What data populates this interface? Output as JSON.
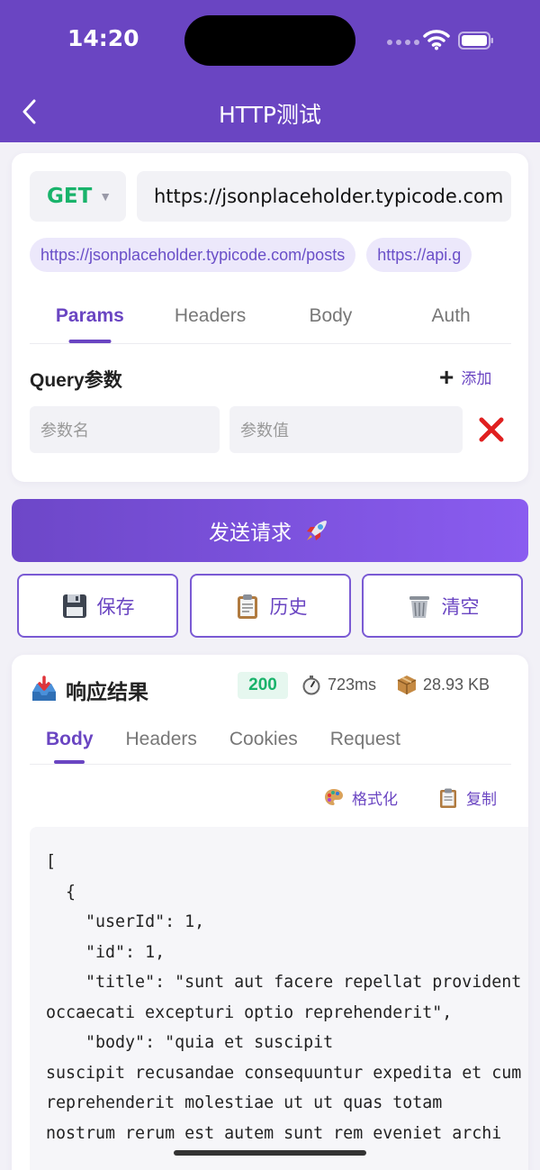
{
  "status_bar": {
    "time": "14:20"
  },
  "nav": {
    "title": "HTTP测试"
  },
  "request": {
    "method": "GET",
    "url": "https://jsonplaceholder.typicode.com",
    "quick_urls": [
      "https://jsonplaceholder.typicode.com/posts",
      "https://api.g"
    ],
    "tabs": [
      "Params",
      "Headers",
      "Body",
      "Auth"
    ],
    "active_tab": "Params",
    "query_title": "Query参数",
    "add_label": "添加",
    "param_name_placeholder": "参数名",
    "param_value_placeholder": "参数值"
  },
  "send_label": "发送请求",
  "actions": {
    "save": "保存",
    "history": "历史",
    "clear": "清空"
  },
  "response": {
    "title": "响应结果",
    "status_code": "200",
    "time": "723ms",
    "size": "28.93 KB",
    "tabs": [
      "Body",
      "Headers",
      "Cookies",
      "Request"
    ],
    "active_tab": "Body",
    "format_label": "格式化",
    "copy_label": "复制",
    "body_text": "[\n  {\n    \"userId\": 1,\n    \"id\": 1,\n    \"title\": \"sunt aut facere repellat provident occaecati excepturi optio reprehenderit\",\n    \"body\": \"quia et suscipit\nsuscipit recusandae consequuntur expedita et cum\nreprehenderit molestiae ut ut quas totam\nnostrum rerum est autem sunt rem eveniet archi"
  },
  "colors": {
    "primary": "#6a45c2",
    "method_get": "#19b36b",
    "status_ok": "#19b36b",
    "delete": "#e02020"
  },
  "icons": {
    "back": "chevron-left-icon",
    "add": "plus-icon",
    "delete": "close-x-icon",
    "send": "rocket-icon",
    "save": "floppy-disk-icon",
    "history": "clipboard-icon",
    "clear": "trash-can-icon",
    "response": "inbox-tray-icon",
    "time": "stopwatch-icon",
    "size": "package-icon",
    "format": "palette-icon",
    "copy": "clipboard-icon"
  }
}
